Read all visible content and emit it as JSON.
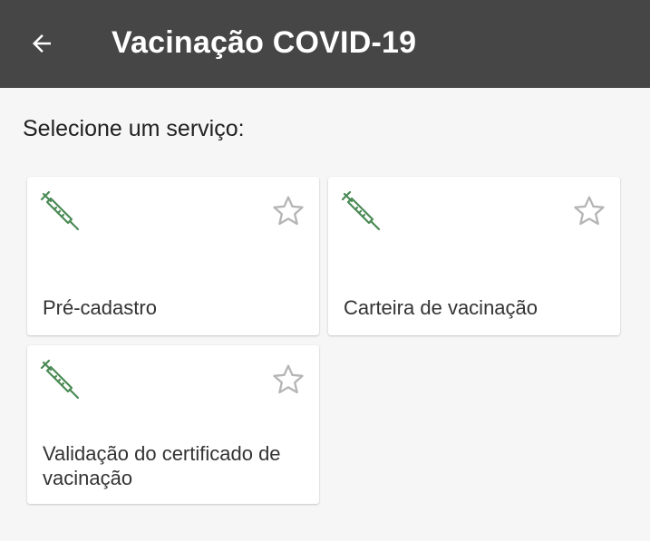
{
  "header": {
    "title": "Vacinação COVID-19",
    "back_icon": "arrow-left-icon"
  },
  "main": {
    "section_title": "Selecione um serviço:",
    "services": [
      {
        "label": "Pré-cadastro",
        "icon": "syringe-icon",
        "favorite": false
      },
      {
        "label": "Carteira de vacinação",
        "icon": "syringe-icon",
        "favorite": false
      },
      {
        "label": "Validação do certificado de vacinação",
        "icon": "syringe-icon",
        "favorite": false
      }
    ]
  },
  "colors": {
    "appbar": "#464646",
    "icon_green": "#4a8a55",
    "star_gray": "#b5b5b5",
    "background": "#f6f6f6"
  }
}
